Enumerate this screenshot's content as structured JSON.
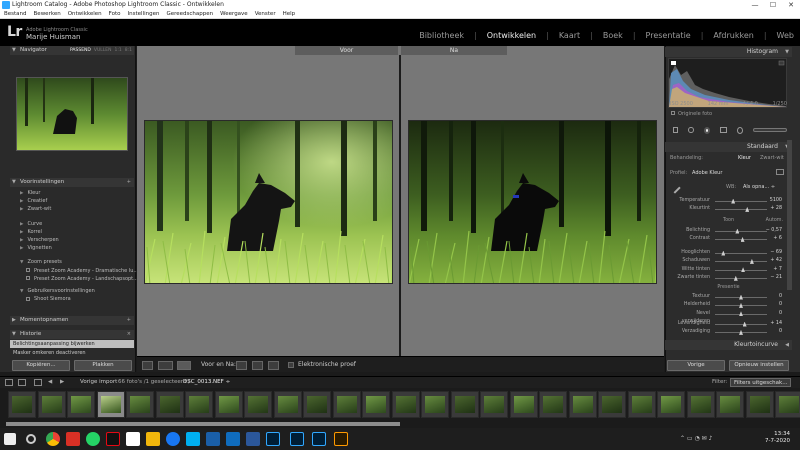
{
  "window": {
    "title": "Lightroom Catalog - Adobe Photoshop Lightroom Classic - Ontwikkelen",
    "minimize": "—",
    "maximize": "☐",
    "close": "✕"
  },
  "menu": [
    "Bestand",
    "Bewerken",
    "Ontwikkelen",
    "Foto",
    "Instellingen",
    "Gereedschappen",
    "Weergave",
    "Venster",
    "Help"
  ],
  "identity": {
    "logo": "Lr",
    "product": "Adobe Lightroom Classic",
    "user": "Marije Huisman"
  },
  "modules": [
    {
      "label": "Bibliotheek",
      "active": false
    },
    {
      "label": "Ontwikkelen",
      "active": true
    },
    {
      "label": "Kaart",
      "active": false
    },
    {
      "label": "Boek",
      "active": false
    },
    {
      "label": "Presentatie",
      "active": false
    },
    {
      "label": "Afdrukken",
      "active": false
    },
    {
      "label": "Web",
      "active": false
    }
  ],
  "navigator": {
    "title": "Navigator",
    "fit": "PASSEND",
    "fill": "VULLEN",
    "z1": "1:1",
    "z2": "8:1"
  },
  "presets": {
    "title": "Voorinstellingen",
    "add": "+",
    "groups1": [
      "Kleur",
      "Creatief",
      "Zwart-wit"
    ],
    "groups2": [
      "Curve",
      "Korrel",
      "Verscherpen",
      "Vignetten"
    ],
    "zoom_group": "Zoom presets",
    "zoom_items": [
      "Preset Zoom Academy - Dramatische lu...",
      "Preset Zoom Academy - Landschapsopt..."
    ],
    "user_group": "Gebruikersvoorinstellingen",
    "user_items": [
      "Shoot Siemora"
    ]
  },
  "snapshots": {
    "title": "Momentopnamen",
    "add": "+"
  },
  "history": {
    "title": "Historie",
    "close": "×",
    "items": [
      "Belichtingsaanpassing bijwerken",
      "Masker omkeren deactiveren"
    ]
  },
  "left_buttons": {
    "copy": "Kopiëren...",
    "paste": "Plakken"
  },
  "views": {
    "before": "Voor",
    "after": "Na"
  },
  "toolbar": {
    "before_after": "Voor en Na:",
    "soft_proof": "Elektronische proef"
  },
  "histogram": {
    "title": "Histogram",
    "iso": "ISO 2500",
    "focal": "142 mm",
    "aperture": "f / 4.0",
    "shutter": "1/250",
    "original": "Originele foto"
  },
  "basic": {
    "title": "Standaard",
    "treatment_label": "Behandeling:",
    "color": "Kleur",
    "bw": "Zwart-wit",
    "profile_label": "Profiel:",
    "profile_value": "Adobe Kleur",
    "wb_label": "WB:",
    "wb_value": "Als opna... ÷",
    "tone_section": "Toon",
    "tone_auto": "Autom.",
    "presence_section": "Presentie"
  },
  "sliders_wb": [
    {
      "label": "Temperatuur",
      "value": "5100",
      "pos": 0.35
    },
    {
      "label": "Kleurtint",
      "value": "+ 28",
      "pos": 0.62
    }
  ],
  "sliders_tone": [
    {
      "label": "Belichting",
      "value": "− 0,57",
      "pos": 0.43
    },
    {
      "label": "Contrast",
      "value": "+ 6",
      "pos": 0.53
    }
  ],
  "sliders_tone2": [
    {
      "label": "Hooglichten",
      "value": "− 69",
      "pos": 0.16
    },
    {
      "label": "Schaduwen",
      "value": "+ 42",
      "pos": 0.71
    },
    {
      "label": "Witte tinten",
      "value": "+ 7",
      "pos": 0.54
    },
    {
      "label": "Zwarte tinten",
      "value": "− 21",
      "pos": 0.4
    }
  ],
  "sliders_presence": [
    {
      "label": "Textuur",
      "value": "0",
      "pos": 0.5
    },
    {
      "label": "Helderheid",
      "value": "0",
      "pos": 0.5
    },
    {
      "label": "Nevel verwijderen",
      "value": "0",
      "pos": 0.5
    }
  ],
  "sliders_presence2": [
    {
      "label": "Levendigheid",
      "value": "+ 14",
      "pos": 0.57
    },
    {
      "label": "Verzadiging",
      "value": "0",
      "pos": 0.5
    }
  ],
  "tone_curve": {
    "title": "Kleurtoincurve"
  },
  "right_buttons": {
    "prev": "Vorige",
    "reset": "Opnieuw instellen"
  },
  "filmstrip": {
    "pages": "1  2",
    "source": "Vorige import",
    "count": "66 foto's /1 geselecteerd /",
    "file": "DSC_0013.NEF ÷",
    "filter_label": "Filter:",
    "filter_value": "Filters uitgeschak..."
  },
  "clock": {
    "time": "13:34",
    "date": "7-7-2020"
  }
}
